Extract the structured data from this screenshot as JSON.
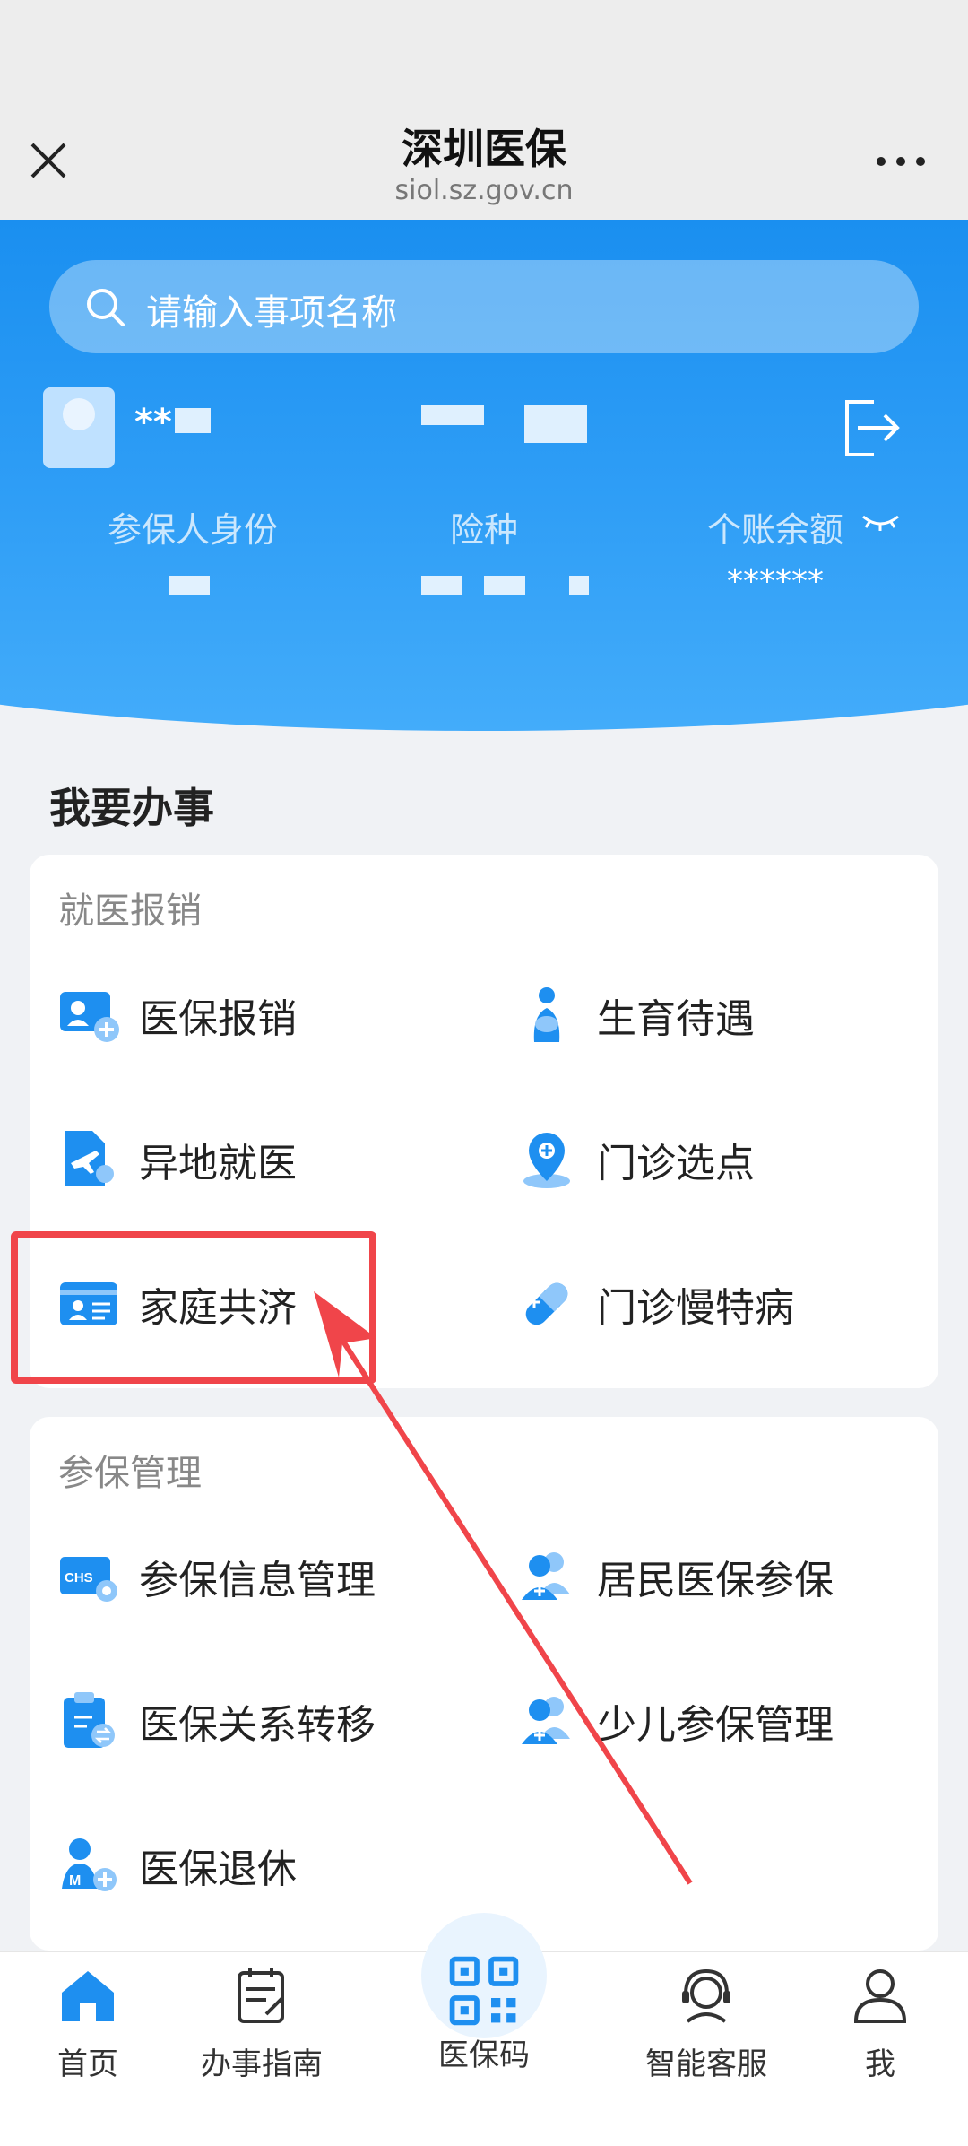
{
  "titlebar": {
    "title": "深圳医保",
    "subtitle": "siol.sz.gov.cn"
  },
  "header": {
    "search_placeholder": "请输入事项名称",
    "user_name": "**",
    "stats": [
      {
        "label": "参保人身份",
        "value": ""
      },
      {
        "label": "险种",
        "value": ""
      },
      {
        "label": "个账余额",
        "value": "******"
      }
    ]
  },
  "main": {
    "section_title": "我要办事",
    "groups": [
      {
        "title": "就医报销",
        "items": [
          {
            "label": "医保报销",
            "icon": "user-plus-card-icon"
          },
          {
            "label": "生育待遇",
            "icon": "maternity-icon"
          },
          {
            "label": "异地就医",
            "icon": "plane-person-icon"
          },
          {
            "label": "门诊选点",
            "icon": "location-pin-icon"
          },
          {
            "label": "家庭共济",
            "icon": "id-card-icon"
          },
          {
            "label": "门诊慢特病",
            "icon": "pill-capsule-icon"
          }
        ]
      },
      {
        "title": "参保管理",
        "items": [
          {
            "label": "参保信息管理",
            "icon": "chs-card-gear-icon"
          },
          {
            "label": "居民医保参保",
            "icon": "people-plus-icon"
          },
          {
            "label": "医保关系转移",
            "icon": "clipboard-transfer-icon"
          },
          {
            "label": "少儿参保管理",
            "icon": "child-people-icon"
          },
          {
            "label": "医保退休",
            "icon": "retire-person-icon"
          }
        ]
      }
    ]
  },
  "bottom_nav": [
    {
      "label": "首页",
      "icon": "home-icon",
      "active": true
    },
    {
      "label": "办事指南",
      "icon": "guide-icon",
      "active": false
    },
    {
      "label": "医保码",
      "icon": "qr-code-icon",
      "active": false
    },
    {
      "label": "智能客服",
      "icon": "customer-service-icon",
      "active": false
    },
    {
      "label": "我",
      "icon": "user-icon",
      "active": false
    }
  ],
  "colors": {
    "brand_blue": "#1a8ff0",
    "annotation_red": "#f0454a"
  }
}
